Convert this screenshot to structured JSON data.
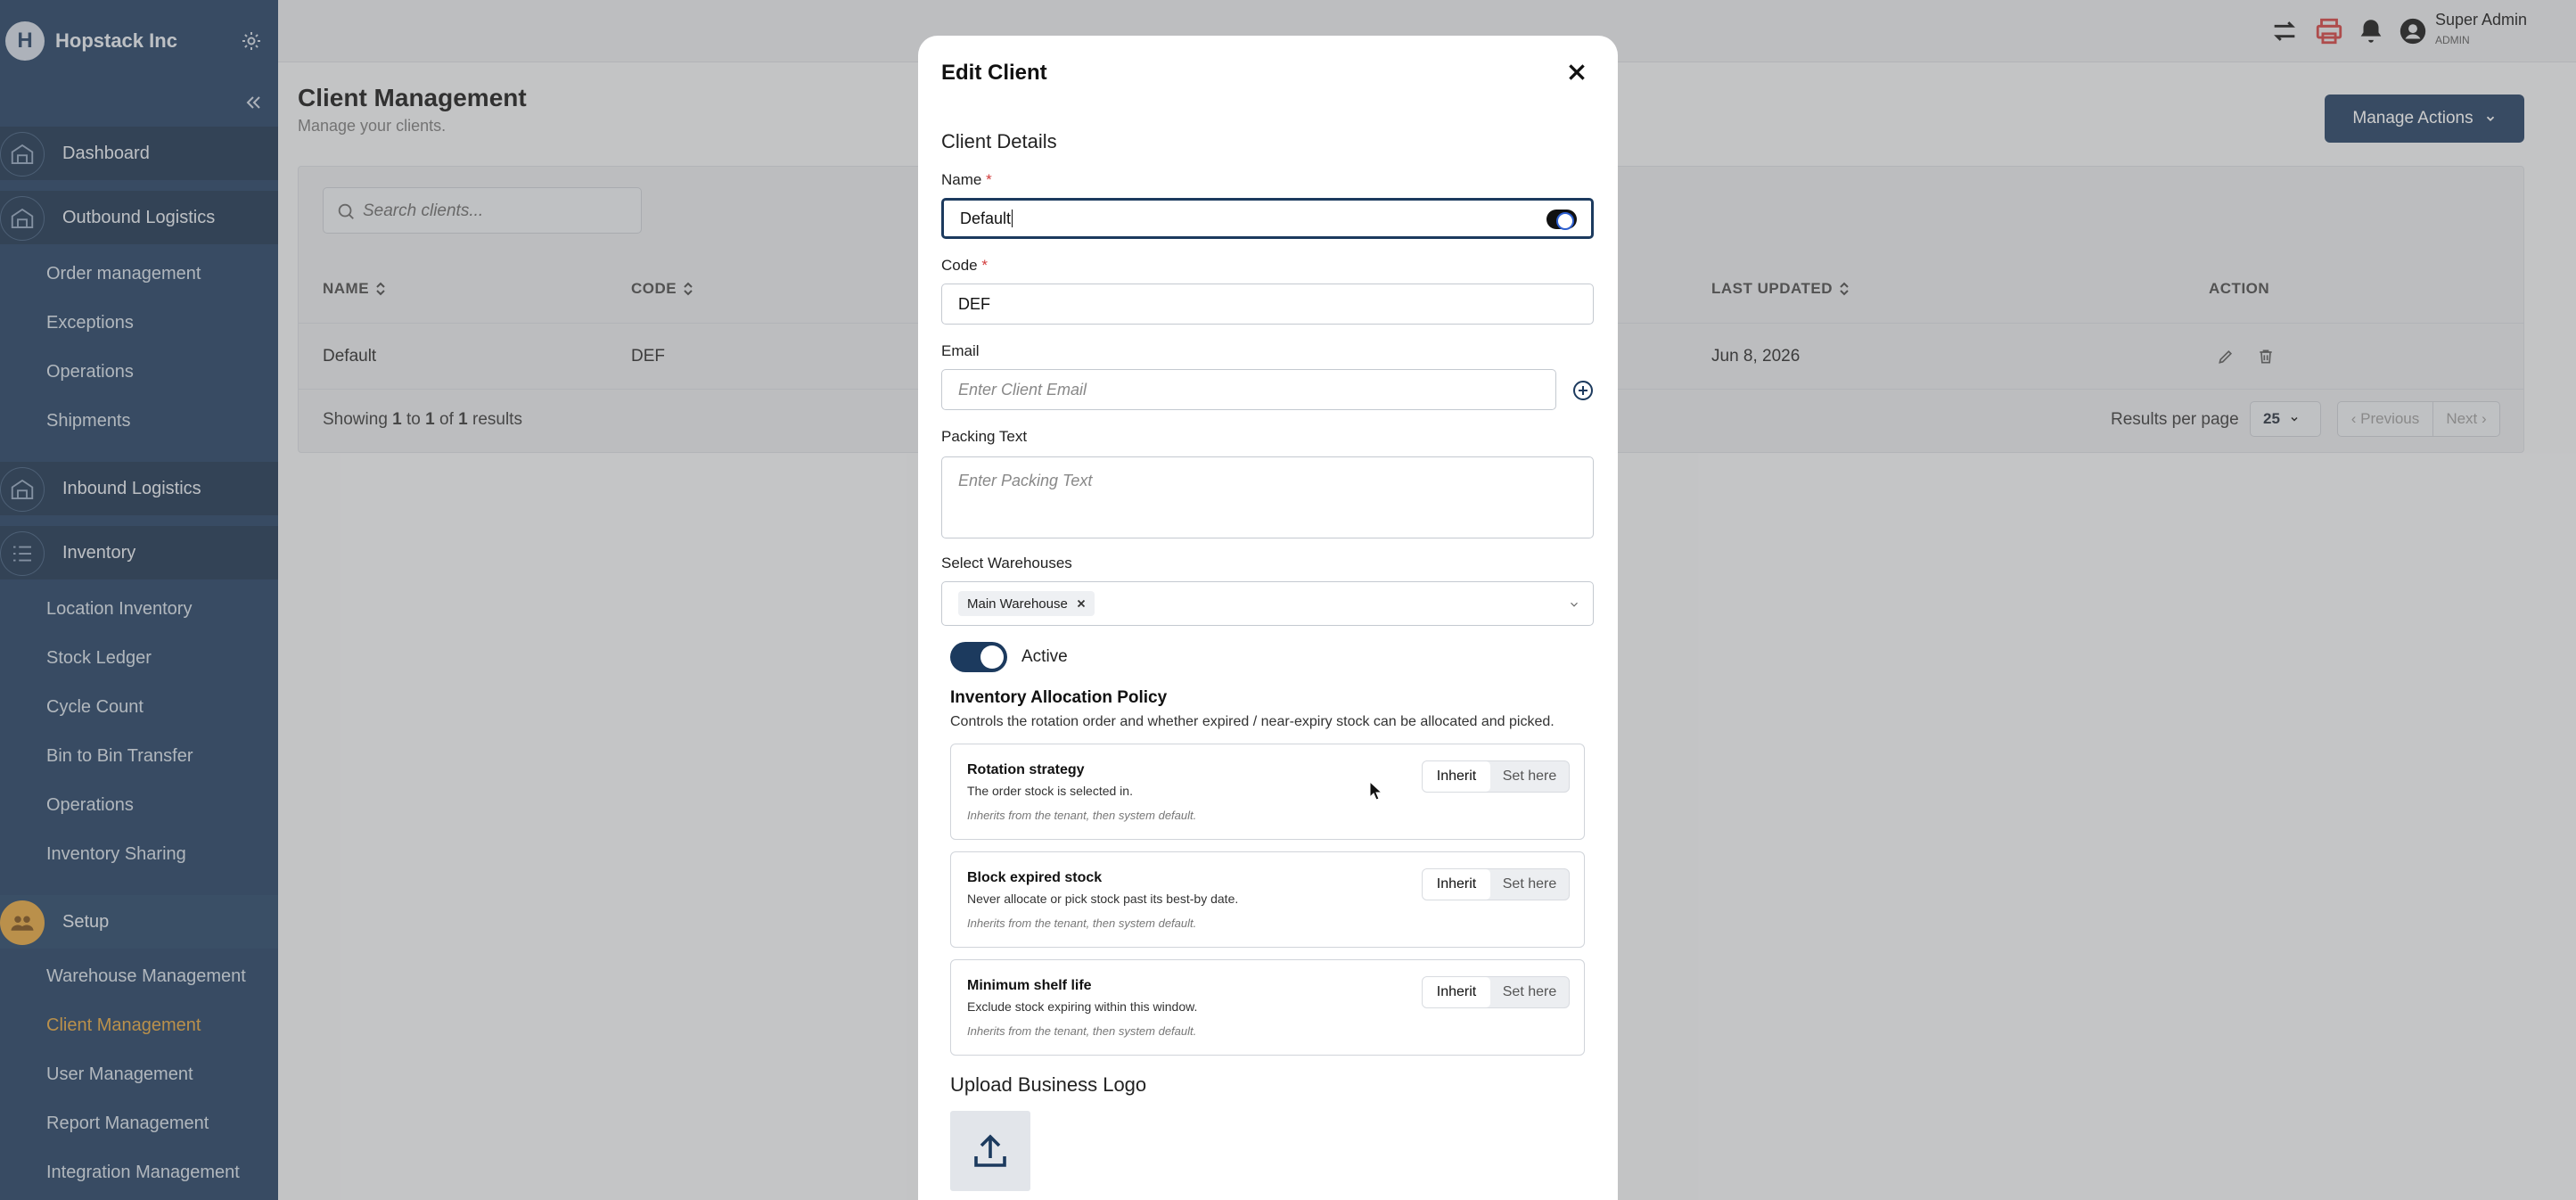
{
  "brand": {
    "name": "Hopstack Inc",
    "logo_letter": "H"
  },
  "sidebar": {
    "dashboard": "Dashboard",
    "outbound": "Outbound Logistics",
    "outbound_items": [
      "Order management",
      "Exceptions",
      "Operations",
      "Shipments"
    ],
    "inbound": "Inbound Logistics",
    "inventory": "Inventory",
    "inventory_items": [
      "Location Inventory",
      "Stock Ledger",
      "Cycle Count",
      "Bin to Bin Transfer",
      "Operations",
      "Inventory Sharing"
    ],
    "setup": "Setup",
    "setup_items": [
      "Warehouse Management",
      "Client Management",
      "User Management",
      "Report Management",
      "Integration Management"
    ]
  },
  "header": {
    "user_name": "Super Admin",
    "user_role": "ADMIN"
  },
  "page": {
    "title": "Client Management",
    "subtitle": "Manage your clients.",
    "manage_actions": "Manage Actions",
    "search_placeholder": "Search clients..."
  },
  "table": {
    "headers": {
      "name": "NAME",
      "code": "CODE",
      "last_updated": "LAST UPDATED",
      "action": "ACTION"
    },
    "rows": [
      {
        "name": "Default",
        "code": "DEF",
        "last_updated": "Jun 8, 2026"
      }
    ],
    "showing": {
      "prefix": "Showing ",
      "from": "1",
      "to_word": " to ",
      "to": "1",
      "of_word": " of ",
      "total": "1",
      "suffix": " results"
    },
    "results_per_page_label": "Results per page",
    "results_per_page": "25",
    "previous": "Previous",
    "next": "Next"
  },
  "modal": {
    "title": "Edit Client",
    "section": "Client Details",
    "name_label": "Name",
    "name_value": "Default",
    "code_label": "Code",
    "code_value": "DEF",
    "required_mark": "*",
    "email_label": "Email",
    "email_placeholder": "Enter Client Email",
    "packing_label": "Packing Text",
    "packing_placeholder": "Enter Packing Text",
    "warehouses_label": "Select Warehouses",
    "warehouse_chip": "Main Warehouse",
    "active_label": "Active",
    "policy_title": "Inventory Allocation Policy",
    "policy_desc": "Controls the rotation order and whether expired / near-expiry stock can be allocated and picked.",
    "policies": [
      {
        "title": "Rotation strategy",
        "desc": "The order stock is selected in.",
        "note": "Inherits from the tenant, then system default.",
        "opt_a": "Inherit",
        "opt_b": "Set here"
      },
      {
        "title": "Block expired stock",
        "desc": "Never allocate or pick stock past its best-by date.",
        "note": "Inherits from the tenant, then system default.",
        "opt_a": "Inherit",
        "opt_b": "Set here"
      },
      {
        "title": "Minimum shelf life",
        "desc": "Exclude stock expiring within this window.",
        "note": "Inherits from the tenant, then system default.",
        "opt_a": "Inherit",
        "opt_b": "Set here"
      }
    ],
    "logo_title": "Upload Business Logo"
  }
}
